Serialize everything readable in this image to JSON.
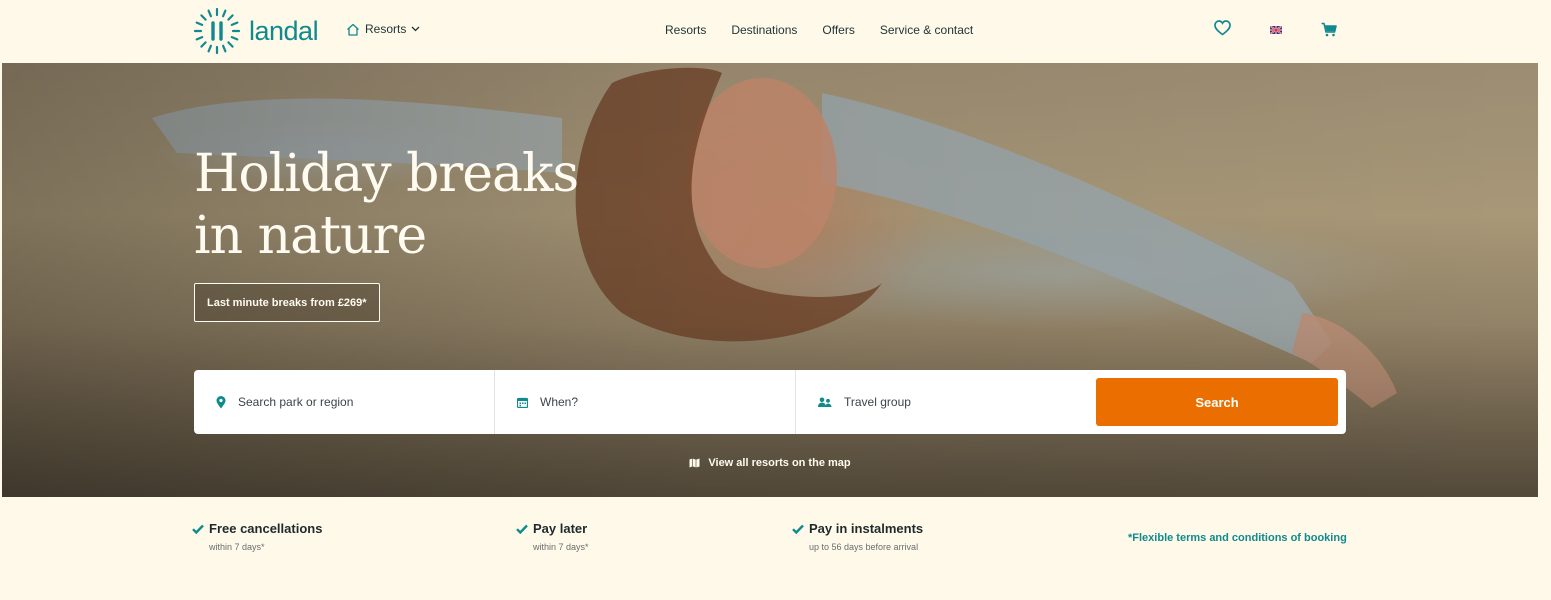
{
  "header": {
    "logo_text": "landal",
    "resorts_menu_label": "Resorts",
    "nav": [
      "Resorts",
      "Destinations",
      "Offers",
      "Service & contact"
    ],
    "icons": [
      "heart-icon",
      "uk-flag-icon",
      "cart-icon"
    ]
  },
  "hero": {
    "title_line1": "Holiday breaks",
    "title_line2": "in nature",
    "promo": "Last minute breaks from £269*",
    "search": {
      "location_placeholder": "Search park or region",
      "when_placeholder": "When?",
      "group_placeholder": "Travel group",
      "button_label": "Search"
    },
    "map_link": "View all resorts on the map"
  },
  "usps": [
    {
      "title": "Free cancellations",
      "subtitle": "within 7 days*"
    },
    {
      "title": "Pay later",
      "subtitle": "within 7 days*"
    },
    {
      "title": "Pay in instalments",
      "subtitle": "up to 56 days before arrival"
    }
  ],
  "terms_link": "*Flexible terms and conditions of booking",
  "colors": {
    "brand_teal": "#108a8f",
    "search_orange": "#eb6f00",
    "page_background": "#fef9e8"
  }
}
